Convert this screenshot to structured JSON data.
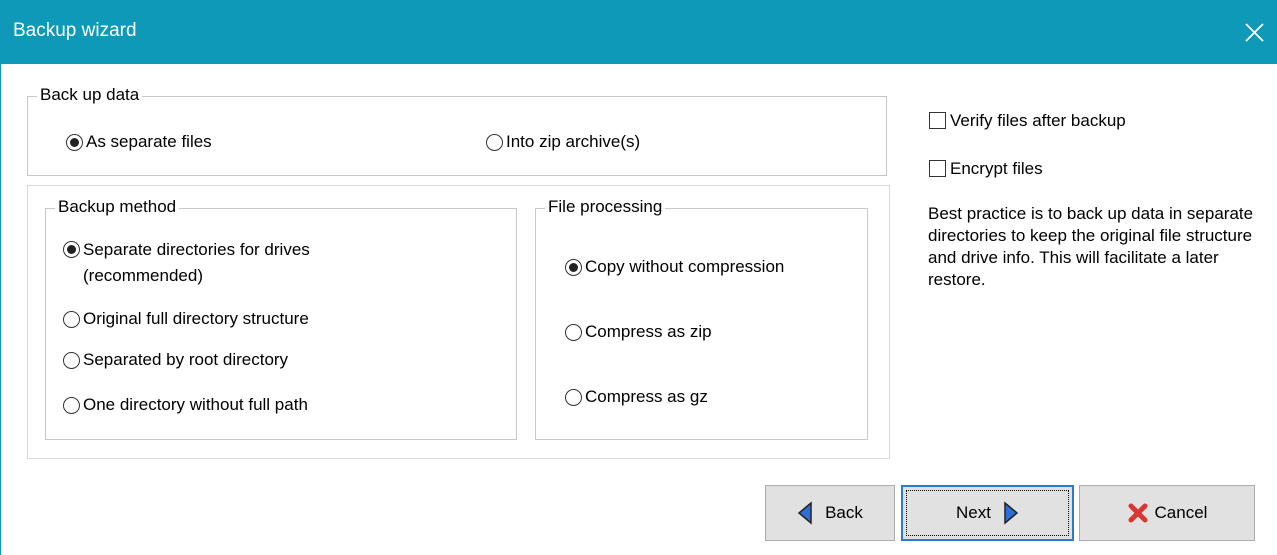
{
  "window": {
    "title": "Backup wizard",
    "close_icon": "close-icon"
  },
  "backup_data": {
    "legend": "Back up data",
    "options": [
      {
        "label": "As separate files",
        "checked": true
      },
      {
        "label": "Into zip archive(s)",
        "checked": false
      }
    ]
  },
  "backup_method": {
    "legend": "Backup method",
    "options": [
      {
        "label": "Separate directories for drives (recommended)",
        "checked": true
      },
      {
        "label": "Original full directory structure",
        "checked": false
      },
      {
        "label": "Separated by root directory",
        "checked": false
      },
      {
        "label": "One directory without full path",
        "checked": false
      }
    ]
  },
  "file_processing": {
    "legend": "File processing",
    "options": [
      {
        "label": "Copy without compression",
        "checked": true
      },
      {
        "label": "Compress as zip",
        "checked": false
      },
      {
        "label": "Compress as gz",
        "checked": false
      }
    ]
  },
  "options": {
    "verify": {
      "label": "Verify files after backup",
      "checked": false
    },
    "encrypt": {
      "label": "Encrypt files",
      "checked": false
    }
  },
  "hint": "Best practice is to back up data in separate directories to keep the original file structure and drive info. This will facilitate a later restore.",
  "buttons": {
    "back": "Back",
    "next": "Next",
    "cancel": "Cancel"
  },
  "colors": {
    "titlebar": "#0f99b8",
    "arrow_fill": "#2d6fd6",
    "cancel_icon": "#d9362f"
  }
}
